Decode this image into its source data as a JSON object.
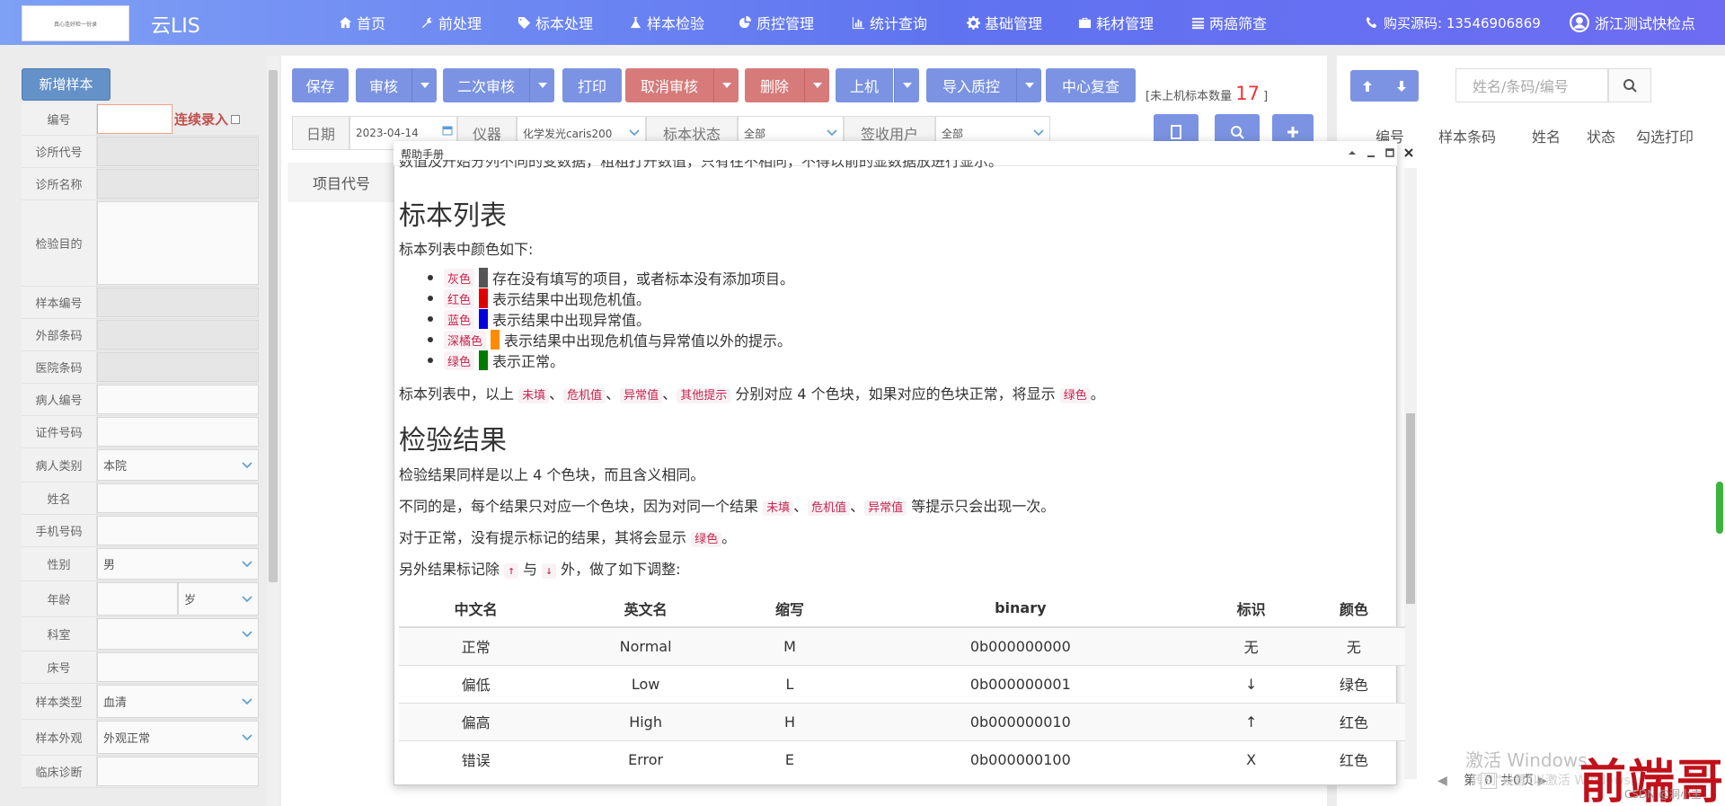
{
  "header": {
    "logo_text": "真心连好检一份录",
    "app_title": "云LIS",
    "nav": [
      {
        "label": "首页",
        "icon": "home-icon"
      },
      {
        "label": "前处理",
        "icon": "wrench-icon"
      },
      {
        "label": "标本处理",
        "icon": "tag-icon"
      },
      {
        "label": "样本检验",
        "icon": "flask-icon"
      },
      {
        "label": "质控管理",
        "icon": "pie-chart-icon"
      },
      {
        "label": "统计查询",
        "icon": "bar-chart-icon"
      },
      {
        "label": "基础管理",
        "icon": "gear-icon"
      },
      {
        "label": "耗材管理",
        "icon": "briefcase-icon"
      },
      {
        "label": "两癌筛查",
        "icon": "list-icon"
      }
    ],
    "phone": "购买源码: 13546906869",
    "user": "浙江测试快检点"
  },
  "left_form": {
    "add_button": "新增样本",
    "continuous_label": "连续录入",
    "fields": [
      {
        "label": "编号",
        "value": ""
      },
      {
        "label": "诊所代号",
        "value": ""
      },
      {
        "label": "诊所名称",
        "value": ""
      },
      {
        "label": "检验目的",
        "value": ""
      },
      {
        "label": "样本编号",
        "value": ""
      },
      {
        "label": "外部条码",
        "value": ""
      },
      {
        "label": "医院条码",
        "value": ""
      },
      {
        "label": "病人编号",
        "value": ""
      },
      {
        "label": "证件号码",
        "value": ""
      },
      {
        "label": "病人类别",
        "value": "本院"
      },
      {
        "label": "姓名",
        "value": ""
      },
      {
        "label": "手机号码",
        "value": ""
      },
      {
        "label": "性别",
        "value": "男"
      },
      {
        "label": "年龄",
        "value": "",
        "unit": "岁"
      },
      {
        "label": "科室",
        "value": ""
      },
      {
        "label": "床号",
        "value": ""
      },
      {
        "label": "样本类型",
        "value": "血清"
      },
      {
        "label": "样本外观",
        "value": "外观正常"
      },
      {
        "label": "临床诊断",
        "value": ""
      }
    ]
  },
  "toolbar": {
    "save": "保存",
    "review": "审核",
    "second_review": "二次审核",
    "print": "打印",
    "cancel_review": "取消审核",
    "delete": "删除",
    "load": "上机",
    "import_qc": "导入质控",
    "center_recheck": "中心复查",
    "unloaded_prefix": "[未上机标本数量",
    "unloaded_count": "17",
    "unloaded_suffix": "]"
  },
  "filters": {
    "date_label": "日期",
    "date_value": "2023-04-14",
    "instrument_label": "仪器",
    "instrument_value": "化学发光caris200",
    "status_label": "标本状态",
    "status_value": "全部",
    "signer_label": "签收用户",
    "signer_value": "全部"
  },
  "main_table": {
    "col_header": "项目代号"
  },
  "right_panel": {
    "search_placeholder": "姓名/条码/编号",
    "headers": [
      "编号",
      "样本条码",
      "姓名",
      "状态",
      "勾选打印"
    ],
    "footer_page": "第",
    "footer_page_num": "0",
    "footer_total": "共0页"
  },
  "overlay": {
    "watermark_title": "激活 Windows",
    "watermark_sub": "转到\"设置\"以激活 Windows。",
    "brand": "前端哥",
    "csdn": "CSDN @洞小主"
  },
  "help": {
    "title": "帮助手册",
    "clipped_line": "数值及开始分列不同的变数据，粗粗打开数值，只有在不相同，不得以前的显数据放进行显示。",
    "h_list": "标本列表",
    "list_intro": "标本列表中颜色如下:",
    "colors": [
      {
        "name": "灰色",
        "hex": "#555555",
        "desc": "存在没有填写的项目，或者标本没有添加项目。"
      },
      {
        "name": "红色",
        "hex": "#e00000",
        "desc": "表示结果中出现危机值。"
      },
      {
        "name": "蓝色",
        "hex": "#0000e0",
        "desc": "表示结果中出现异常值。"
      },
      {
        "name": "深橘色",
        "hex": "#ff8c00",
        "desc": "表示结果中出现危机值与异常值以外的提示。"
      },
      {
        "name": "绿色",
        "hex": "#007a00",
        "desc": "表示正常。"
      }
    ],
    "list_note_prefix": "标本列表中，以上",
    "tag_unfilled": "未填",
    "tag_critical": "危机值",
    "tag_abnormal": "异常值",
    "tag_other": "其他提示",
    "list_note_mid": "分别对应 4 个色块，如果对应的色块正常，将显示",
    "tag_green": "绿色",
    "sep": "、",
    "period": "。",
    "h_result": "检验结果",
    "result_p1": "检验结果同样是以上 4 个色块，而且含义相同。",
    "result_p2_prefix": "不同的是，每个结果只对应一个色块，因为对同一个结果",
    "result_p2_suffix": "等提示只会出现一次。",
    "result_p3_prefix": "对于正常，没有提示标记的结果，其将会显示",
    "result_p4_prefix": "另外结果标记除",
    "arrow_up": "↑",
    "and": "与",
    "arrow_down": "↓",
    "result_p4_suffix": "外，做了如下调整:",
    "table_headers": [
      "中文名",
      "英文名",
      "缩写",
      "binary",
      "标识",
      "颜色"
    ],
    "table_rows": [
      [
        "正常",
        "Normal",
        "M",
        "0b000000000",
        "无",
        "无"
      ],
      [
        "偏低",
        "Low",
        "L",
        "0b000000001",
        "↓",
        "绿色"
      ],
      [
        "偏高",
        "High",
        "H",
        "0b000000010",
        "↑",
        "红色"
      ],
      [
        "错误",
        "Error",
        "E",
        "0b000000100",
        "X",
        "红色"
      ]
    ]
  }
}
